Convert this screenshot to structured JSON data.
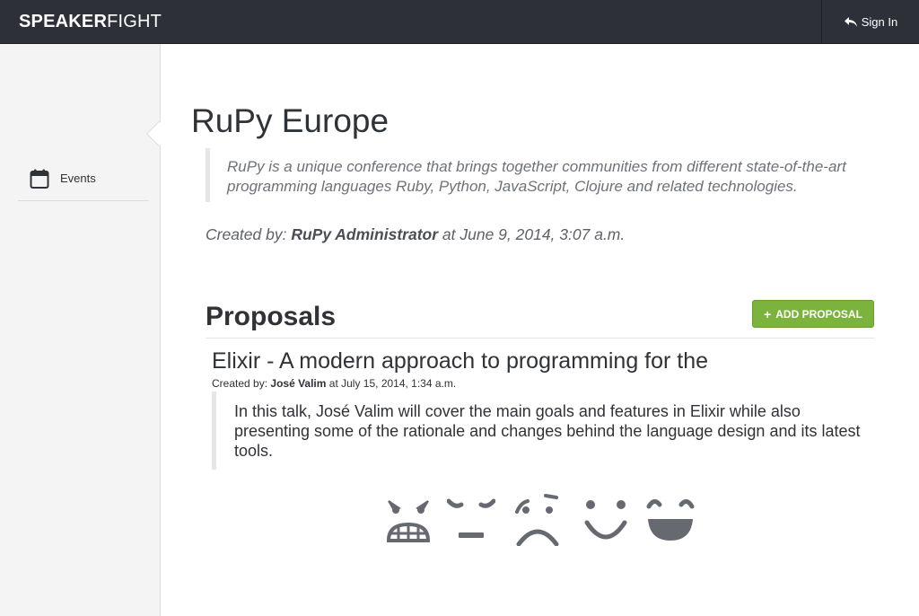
{
  "header": {
    "logo_bold": "SPEAKER",
    "logo_light": "FIGHT",
    "signin_label": "Sign In"
  },
  "sidebar": {
    "items": [
      {
        "label": "Events",
        "icon": "calendar-icon"
      }
    ]
  },
  "event": {
    "title": "RuPy Europe",
    "description": "RuPy is a unique conference that brings together communities from different state-of-the-art programming languages Ruby, Python, JavaScript, Clojure and related technologies.",
    "created_prefix": "Created by:",
    "created_by": "RuPy Administrator",
    "created_at": "at June 9, 2014, 3:07 a.m."
  },
  "proposals": {
    "heading": "Proposals",
    "add_label": "ADD PROPOSAL",
    "items": [
      {
        "title": "Elixir - A modern approach to programming for the",
        "created_prefix": "Created by:",
        "author": "José Valim",
        "created_at": "at July 15, 2014, 1:34 a.m.",
        "description": "In this talk, José Valim will cover the main goals and features in Elixir while also presenting some of the rationale and changes behind the language design and its latest tools."
      }
    ],
    "vote_icons": [
      "angry-face-icon",
      "neutral-face-icon",
      "sad-face-icon",
      "smile-face-icon",
      "grin-face-icon"
    ]
  },
  "colors": {
    "topbar": "#2d3038",
    "accent_green": "#7bb33c",
    "icon_gray": "#666a70"
  }
}
